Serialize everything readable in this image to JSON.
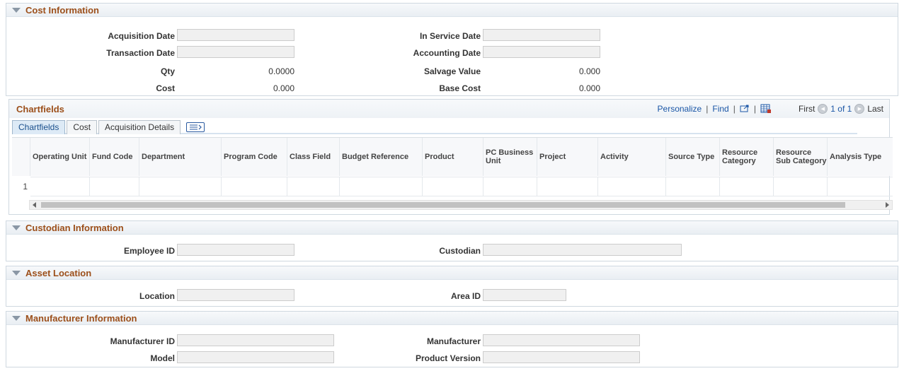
{
  "cost_info": {
    "title": "Cost Information",
    "acquisition_date_label": "Acquisition Date",
    "acquisition_date_value": "",
    "transaction_date_label": "Transaction Date",
    "transaction_date_value": "",
    "qty_label": "Qty",
    "qty_value": "0.0000",
    "cost_label": "Cost",
    "cost_value": "0.000",
    "in_service_date_label": "In Service Date",
    "in_service_date_value": "",
    "accounting_date_label": "Accounting Date",
    "accounting_date_value": "",
    "salvage_value_label": "Salvage Value",
    "salvage_value_value": "0.000",
    "base_cost_label": "Base Cost",
    "base_cost_value": "0.000"
  },
  "chartfields": {
    "title": "Chartfields",
    "nav": {
      "personalize": "Personalize",
      "find": "Find",
      "first": "First",
      "range": "1 of 1",
      "last": "Last"
    },
    "tabs": [
      "Chartfields",
      "Cost",
      "Acquisition Details"
    ],
    "columns": [
      "Operating Unit",
      "Fund Code",
      "Department",
      "Program Code",
      "Class Field",
      "Budget Reference",
      "Product",
      "PC Business Unit",
      "Project",
      "Activity",
      "Source Type",
      "Resource Category",
      "Resource Sub Category",
      "Analysis Type"
    ],
    "row_number": "1"
  },
  "custodian_info": {
    "title": "Custodian Information",
    "employee_id_label": "Employee ID",
    "employee_id_value": "",
    "custodian_label": "Custodian",
    "custodian_value": ""
  },
  "asset_location": {
    "title": "Asset Location",
    "location_label": "Location",
    "location_value": "",
    "area_id_label": "Area ID",
    "area_id_value": ""
  },
  "manufacturer_info": {
    "title": "Manufacturer Information",
    "manufacturer_id_label": "Manufacturer ID",
    "manufacturer_id_value": "",
    "model_label": "Model",
    "model_value": "",
    "manufacturer_label": "Manufacturer",
    "manufacturer_value": "",
    "product_version_label": "Product Version",
    "product_version_value": ""
  }
}
